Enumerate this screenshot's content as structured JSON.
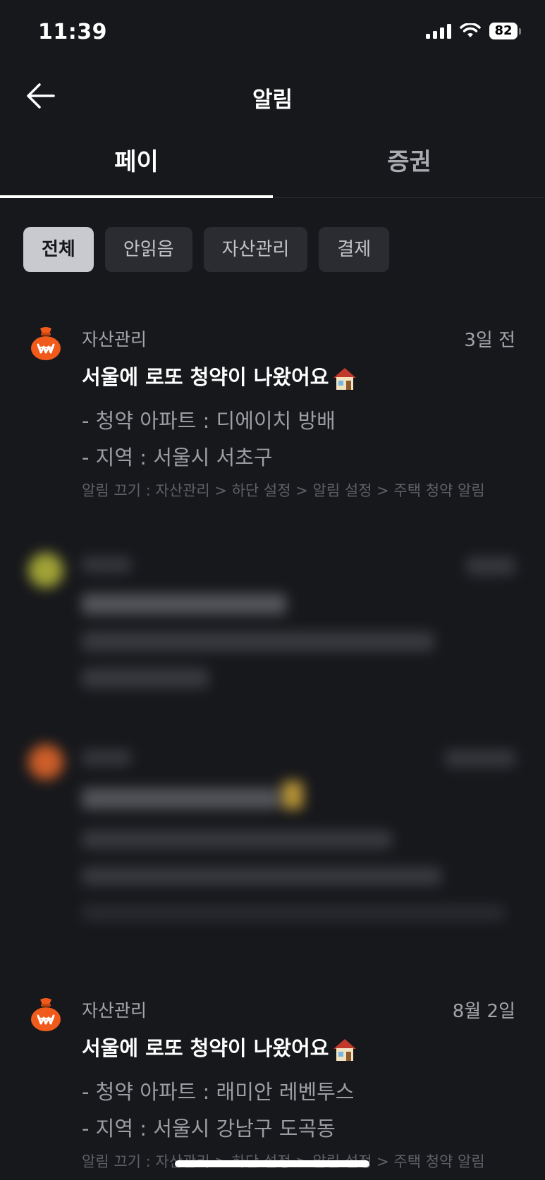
{
  "status_bar": {
    "time": "11:39",
    "battery": "82"
  },
  "header": {
    "title": "알림"
  },
  "tabs": [
    {
      "label": "페이",
      "active": true
    },
    {
      "label": "증권",
      "active": false
    }
  ],
  "filters": [
    {
      "label": "전체",
      "selected": true
    },
    {
      "label": "안읽음",
      "selected": false
    },
    {
      "label": "자산관리",
      "selected": false
    },
    {
      "label": "결제",
      "selected": false
    }
  ],
  "notifications": [
    {
      "category": "자산관리",
      "date": "3일 전",
      "title": "서울에 로또 청약이 나왔어요",
      "lines": [
        "- 청약 아파트 : 디에이치 방배",
        "- 지역 : 서울시 서초구"
      ],
      "footer": "알림 끄기 : 자산관리 > 하단 설정 > 알림 설정 > 주택 청약 알림",
      "icon": "money-bag-icon"
    },
    {
      "category": "자산관리",
      "date": "8월 2일",
      "title": "서울에 로또 청약이 나왔어요",
      "lines": [
        "- 청약 아파트 : 래미안 레벤투스",
        "- 지역 : 서울시 강남구 도곡동"
      ],
      "footer": "알림 끄기 : 자산관리 > 하단 설정 > 알림 설정 > 주택 청약 알림",
      "icon": "money-bag-icon"
    }
  ],
  "colors": {
    "background": "#17181c",
    "icon_orange": "#f05a1a",
    "chip_bg": "#2a2c31",
    "chip_selected": "#c8cacf"
  }
}
